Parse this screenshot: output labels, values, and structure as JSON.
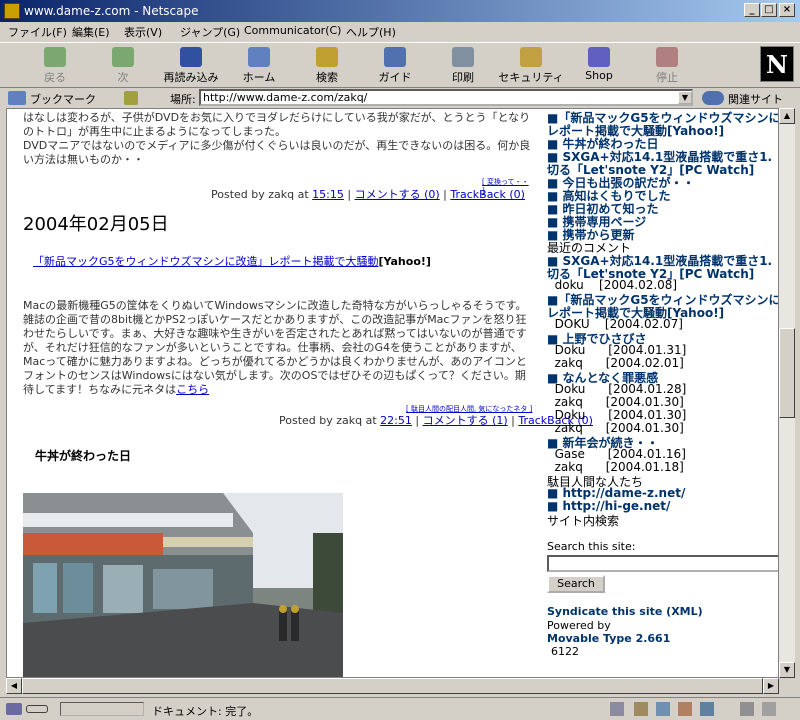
{
  "window": {
    "title": "www.dame-z.com - Netscape"
  },
  "menu": [
    "ファイル(F)",
    "編集(E)",
    "表示(V)",
    "ジャンプ(G)",
    "Communicator(C)",
    "ヘルプ(H)"
  ],
  "toolbar": [
    {
      "label": "戻る",
      "enabled": false,
      "icon": "back-arrow-icon",
      "color": "#7aa870"
    },
    {
      "label": "次",
      "enabled": false,
      "icon": "forward-arrow-icon",
      "color": "#7aa870"
    },
    {
      "label": "再読み込み",
      "enabled": true,
      "icon": "reload-icon",
      "color": "#3050a0"
    },
    {
      "label": "ホーム",
      "enabled": true,
      "icon": "home-icon",
      "color": "#6080c0"
    },
    {
      "label": "検索",
      "enabled": true,
      "icon": "search-icon",
      "color": "#c0a030"
    },
    {
      "label": "ガイド",
      "enabled": true,
      "icon": "guide-icon",
      "color": "#5070b0"
    },
    {
      "label": "印刷",
      "enabled": true,
      "icon": "print-icon",
      "color": "#8090a0"
    },
    {
      "label": "セキュリティ",
      "enabled": true,
      "icon": "lock-icon",
      "color": "#c0a040"
    },
    {
      "label": "Shop",
      "enabled": true,
      "icon": "shop-icon",
      "color": "#6060c0"
    },
    {
      "label": "停止",
      "enabled": false,
      "icon": "stop-icon",
      "color": "#b08080"
    }
  ],
  "logo": "N",
  "location": {
    "bookmark_label": "ブックマーク",
    "place_label": "場所:",
    "url": "http://www.dame-z.com/zakq/",
    "related_label": "関連サイト"
  },
  "main": {
    "intro": "はなしは変わるが、子供がDVDをお気に入りでヨダレだらけにしている我が家だが、とうとう「となりのトトロ」が再生中に止まるようになってしまった。\nDVDマニアではないのでメディアに多少傷が付くぐらいは良いのだが、再生できないのは困る。何か良い方法は無いものか・・",
    "note1": "[ 変換って・・ ]",
    "post1": {
      "prefix": "Posted by zakq at ",
      "time": "15:15",
      "comment": "コメントする (0)",
      "trackback": "TrackBack (0)"
    },
    "date": "2004年02月05日",
    "headline_link": "「新品マックG5をウィンドウズマシンに改造」レポート掲載で大騒動",
    "headline_suffix": "[Yahoo!]",
    "entry_text": "Macの最新機種G5の筐体をくりぬいてWindowsマシンに改造した奇特な方がいらっしゃるそうです。雑誌の企画で昔の8bit機とかPS2っぽいケースだとかありますが、この改造記事がMacファンを怒り狂わせたらしいです。まぁ、大好きな趣味や生きがいを否定されたとあれば黙ってはいないのが普通ですが、それだけ狂信的なファンが多いということですね。仕事柄、会社のG4を使うことがありますが、Macって確かに魅力ありますよね。どっちが優れてるかどうかは良くわかりませんが、あのアイコンとフォントのセンスはWindowsにはない気がします。次のOSではぜひその辺もぱくって？ください。期待してます！ちなみに元ネタは",
    "entry_link": "こちら",
    "note2": "[ 駄目人間の配目人間, 気になったネタ ]",
    "post2": {
      "prefix": "Posted by zakq at ",
      "time": "22:51",
      "comment": "コメントする (1)",
      "trackback": "TrackBack (0)"
    },
    "entry_title": "牛丼が終わった日"
  },
  "sidebar": {
    "items": [
      {
        "text": "■「新品マックG5をウィンドウズマシンに",
        "cls": "sb"
      },
      {
        "text": "レポート掲載で大騒動[Yahoo!]",
        "cls": "sb"
      },
      {
        "text": "■ 牛丼が終わった日",
        "cls": "sb"
      },
      {
        "text": "■ SXGA+対応14.1型液晶搭載で重さ1.",
        "cls": "sb"
      },
      {
        "text": "切る「Let'snote Y2」[PC Watch]",
        "cls": "sb"
      },
      {
        "text": "■ 今日も出張の訳だが・・",
        "cls": "sb"
      },
      {
        "text": "■ 高知はくもりでした",
        "cls": "sb"
      },
      {
        "text": "■ 昨日初めて知った",
        "cls": "sb"
      },
      {
        "text": "■ 携帯専用ページ",
        "cls": "sb"
      },
      {
        "text": "■ 携帯から更新",
        "cls": "sb"
      },
      {
        "text": "最近のコメント",
        "cls": "sbp"
      },
      {
        "text": "■ SXGA+対応14.1型液晶搭載で重さ1.",
        "cls": "sb"
      },
      {
        "text": "切る「Let'snote Y2」[PC Watch]",
        "cls": "sb"
      },
      {
        "text": "  doku    [2004.02.08]",
        "cls": "sbc"
      },
      {
        "text": "■「新品マックG5をウィンドウズマシンに",
        "cls": "sb"
      },
      {
        "text": "レポート掲載で大騒動[Yahoo!]",
        "cls": "sb"
      },
      {
        "text": "  DOKU    [2004.02.07]",
        "cls": "sbc"
      },
      {
        "text": "■ 上野でひさびさ",
        "cls": "sb"
      },
      {
        "text": "  Doku      [2004.01.31]",
        "cls": "sbc"
      },
      {
        "text": "  zakq      [2004.02.01]",
        "cls": "sbc"
      },
      {
        "text": "■ なんとなく罪悪感",
        "cls": "sb"
      },
      {
        "text": "  Doku      [2004.01.28]",
        "cls": "sbc"
      },
      {
        "text": "  zakq      [2004.01.30]",
        "cls": "sbc"
      },
      {
        "text": "  Doku      [2004.01.30]",
        "cls": "sbc"
      },
      {
        "text": "  zakq      [2004.01.30]",
        "cls": "sbc"
      },
      {
        "text": "■ 新年会が続き・・",
        "cls": "sb"
      },
      {
        "text": "  Gase      [2004.01.16]",
        "cls": "sbc"
      },
      {
        "text": "  zakq      [2004.01.18]",
        "cls": "sbc"
      },
      {
        "text": "駄目人間な人たち",
        "cls": "sbp"
      },
      {
        "text": "■ http://dame-z.net/",
        "cls": "sb"
      },
      {
        "text": "■ http://hi-ge.net/",
        "cls": "sb"
      },
      {
        "text": "サイト内検索",
        "cls": "sbp"
      }
    ],
    "search_label": "Search this site:",
    "search_button": "Search",
    "syndicate": "Syndicate this site (XML)",
    "powered_by": "Powered by",
    "mt": "Movable Type 2.661",
    "count": "6122"
  },
  "status": {
    "text": "ドキュメント: 完了。"
  }
}
